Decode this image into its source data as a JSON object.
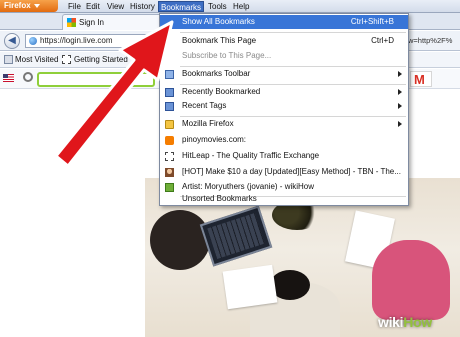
{
  "browser": {
    "app_button": "Firefox",
    "menu": {
      "file": "File",
      "edit": "Edit",
      "view": "View",
      "history": "History",
      "bookmarks": "Bookmarks",
      "tools": "Tools",
      "help": "Help"
    },
    "tab": {
      "title": "Sign In"
    },
    "url": "https://login.live.com",
    "url_right": "w=http%2F%",
    "bookmarks_bar": {
      "most_visited": "Most Visited",
      "getting_started": "Getting Started"
    }
  },
  "bookmarks_menu": {
    "items": [
      {
        "label": "Show All Bookmarks",
        "shortcut": "Ctrl+Shift+B",
        "highlight": true
      },
      {
        "label": "Bookmark This Page",
        "shortcut": "Ctrl+D"
      },
      {
        "label": "Subscribe to This Page...",
        "disabled": true
      },
      {
        "label": "Bookmarks Toolbar",
        "submenu": true,
        "icon": "toolbar-icon"
      },
      {
        "label": "Recently Bookmarked",
        "submenu": true,
        "icon": "recent-icon"
      },
      {
        "label": "Recent Tags",
        "submenu": true,
        "icon": "tags-icon"
      },
      {
        "label": "Mozilla Firefox",
        "submenu": true,
        "icon": "folder-icon"
      },
      {
        "label": "pinoymovies.com:",
        "icon": "blogger-icon"
      },
      {
        "label": "HitLeap - The Quality Traffic Exchange",
        "icon": "page-icon"
      },
      {
        "label": "[HOT] Make $10 a day [Updated][Easy Method] - TBN - The...",
        "icon": "face-icon"
      },
      {
        "label": "Artist: Moryuthers (jovanie) - wikiHow",
        "icon": "wikihow-icon"
      },
      {
        "label": "Unsorted Bookmarks"
      }
    ]
  },
  "watermark": {
    "wiki": "wiki",
    "how": "How"
  },
  "colors": {
    "highlight": "#3875d7",
    "arrow": "#e0161b",
    "firefox_button": "#e26b10"
  }
}
